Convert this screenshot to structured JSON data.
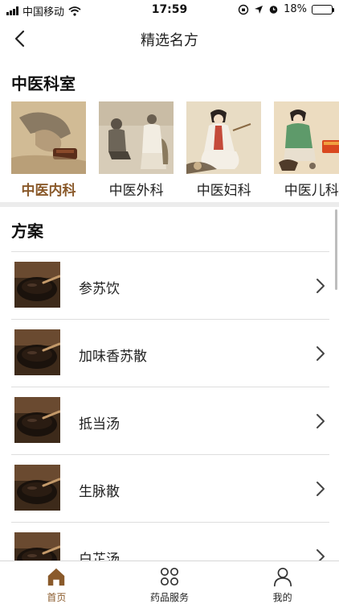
{
  "status_bar": {
    "carrier": "中国移动",
    "time": "17:59",
    "battery": "18%",
    "battery_level": 0.18
  },
  "nav": {
    "title": "精选名方"
  },
  "departments": {
    "title": "中医科室",
    "items": [
      {
        "label": "中医内科",
        "active": true
      },
      {
        "label": "中医外科",
        "active": false
      },
      {
        "label": "中医妇科",
        "active": false
      },
      {
        "label": "中医儿科",
        "active": false
      }
    ]
  },
  "plans": {
    "title": "方案",
    "items": [
      {
        "name": "参苏饮"
      },
      {
        "name": "加味香苏散"
      },
      {
        "name": "抵当汤"
      },
      {
        "name": "生脉散"
      },
      {
        "name": "白芷汤"
      }
    ]
  },
  "tab_bar": {
    "items": [
      {
        "label": "首页",
        "icon": "home-icon",
        "active": true
      },
      {
        "label": "药品服务",
        "icon": "grid-icon",
        "active": false
      },
      {
        "label": "我的",
        "icon": "person-icon",
        "active": false
      }
    ]
  },
  "colors": {
    "accent": "#8a5a2b",
    "battery_low": "#e53935"
  }
}
